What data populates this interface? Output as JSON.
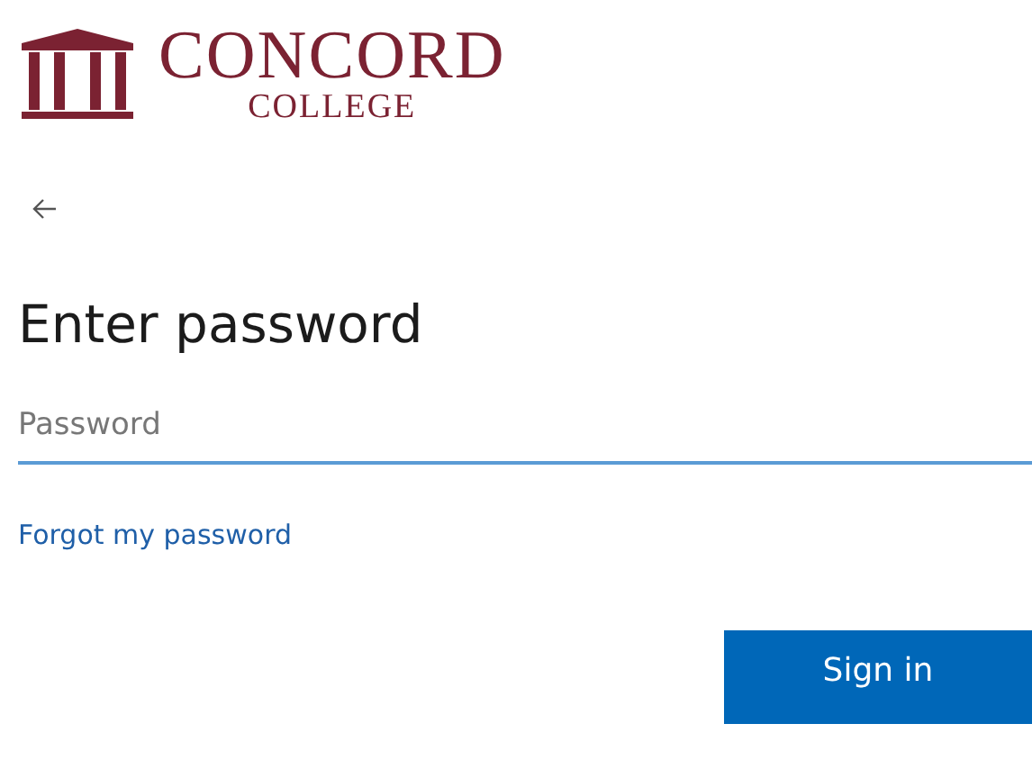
{
  "logo": {
    "name": "CONCORD",
    "subtitle": "COLLEGE"
  },
  "heading": "Enter password",
  "password_field": {
    "placeholder": "Password"
  },
  "forgot_link": "Forgot my password",
  "buttons": [
    {
      "label": "Sign in"
    }
  ]
}
